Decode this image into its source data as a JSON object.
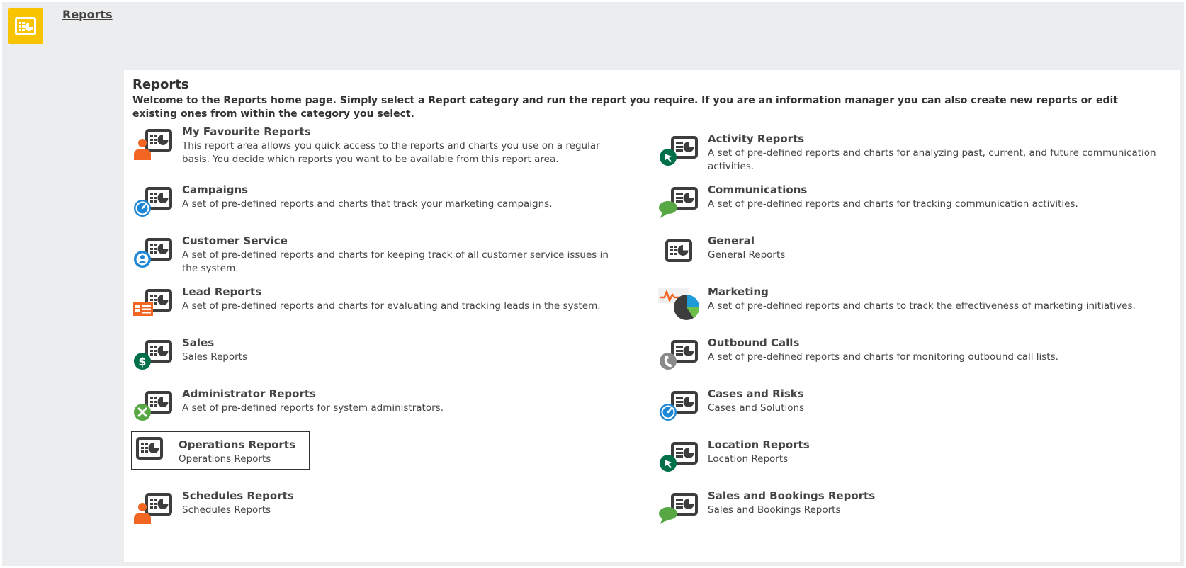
{
  "header": {
    "breadcrumb": "Reports",
    "logo_icon": "reports-icon",
    "accent": "#f8c300"
  },
  "main": {
    "title": "Reports",
    "intro": "Welcome to the Reports home page. Simply select a Report category and run the report you require. If you are an information manager you can also create new reports or edit existing ones from within the category you select."
  },
  "categories": {
    "left": [
      {
        "name": "My Favourite Reports",
        "desc": "This report area allows you quick access to the reports and charts you use on a regular basis. You decide which reports you want to be available from this report area.",
        "icon": "person-report-icon"
      },
      {
        "name": "Campaigns",
        "desc": "A set of pre-defined reports and charts that track your marketing campaigns.",
        "icon": "campaign-report-icon"
      },
      {
        "name": "Customer Service",
        "desc": "A set of pre-defined reports and charts for keeping track of all customer service issues in the system.",
        "icon": "customer-service-report-icon"
      },
      {
        "name": "Lead Reports",
        "desc": "A set of pre-defined reports and charts for evaluating and tracking leads in the system.",
        "icon": "lead-report-icon"
      },
      {
        "name": "Sales",
        "desc": "Sales Reports",
        "icon": "sales-report-icon"
      },
      {
        "name": "Administrator Reports",
        "desc": "A set of pre-defined reports for system administrators.",
        "icon": "admin-report-icon"
      },
      {
        "name": "Operations Reports",
        "desc": "Operations Reports",
        "icon": "report-icon"
      },
      {
        "name": "Schedules Reports",
        "desc": "Schedules Reports",
        "icon": "person-report-icon"
      }
    ],
    "right": [
      {
        "name": "Activity Reports",
        "desc": "A set of pre-defined reports and charts for analyzing past, current, and future communication activities.",
        "icon": "activity-report-icon"
      },
      {
        "name": "Communications",
        "desc": "A set of pre-defined reports and charts for tracking communication activities.",
        "icon": "communication-report-icon"
      },
      {
        "name": "General",
        "desc": "General Reports",
        "icon": "report-icon"
      },
      {
        "name": "Marketing",
        "desc": "A set of pre-defined reports and charts to track the effectiveness of marketing initiatives.",
        "icon": "marketing-report-icon"
      },
      {
        "name": "Outbound Calls",
        "desc": "A set of pre-defined reports and charts for monitoring outbound call lists.",
        "icon": "phone-report-icon"
      },
      {
        "name": "Cases and Risks",
        "desc": "Cases and Solutions",
        "icon": "cases-report-icon"
      },
      {
        "name": "Location Reports",
        "desc": "Location Reports",
        "icon": "location-report-icon"
      },
      {
        "name": "Sales and Bookings Reports",
        "desc": "Sales and Bookings Reports",
        "icon": "communication-report-icon"
      }
    ]
  },
  "colors": {
    "orange": "#f26522",
    "blue": "#1e88d6",
    "green": "#00704a",
    "chat_green": "#57a845",
    "gray": "#8a8a8a",
    "icon_dark": "#3d3d3d"
  }
}
